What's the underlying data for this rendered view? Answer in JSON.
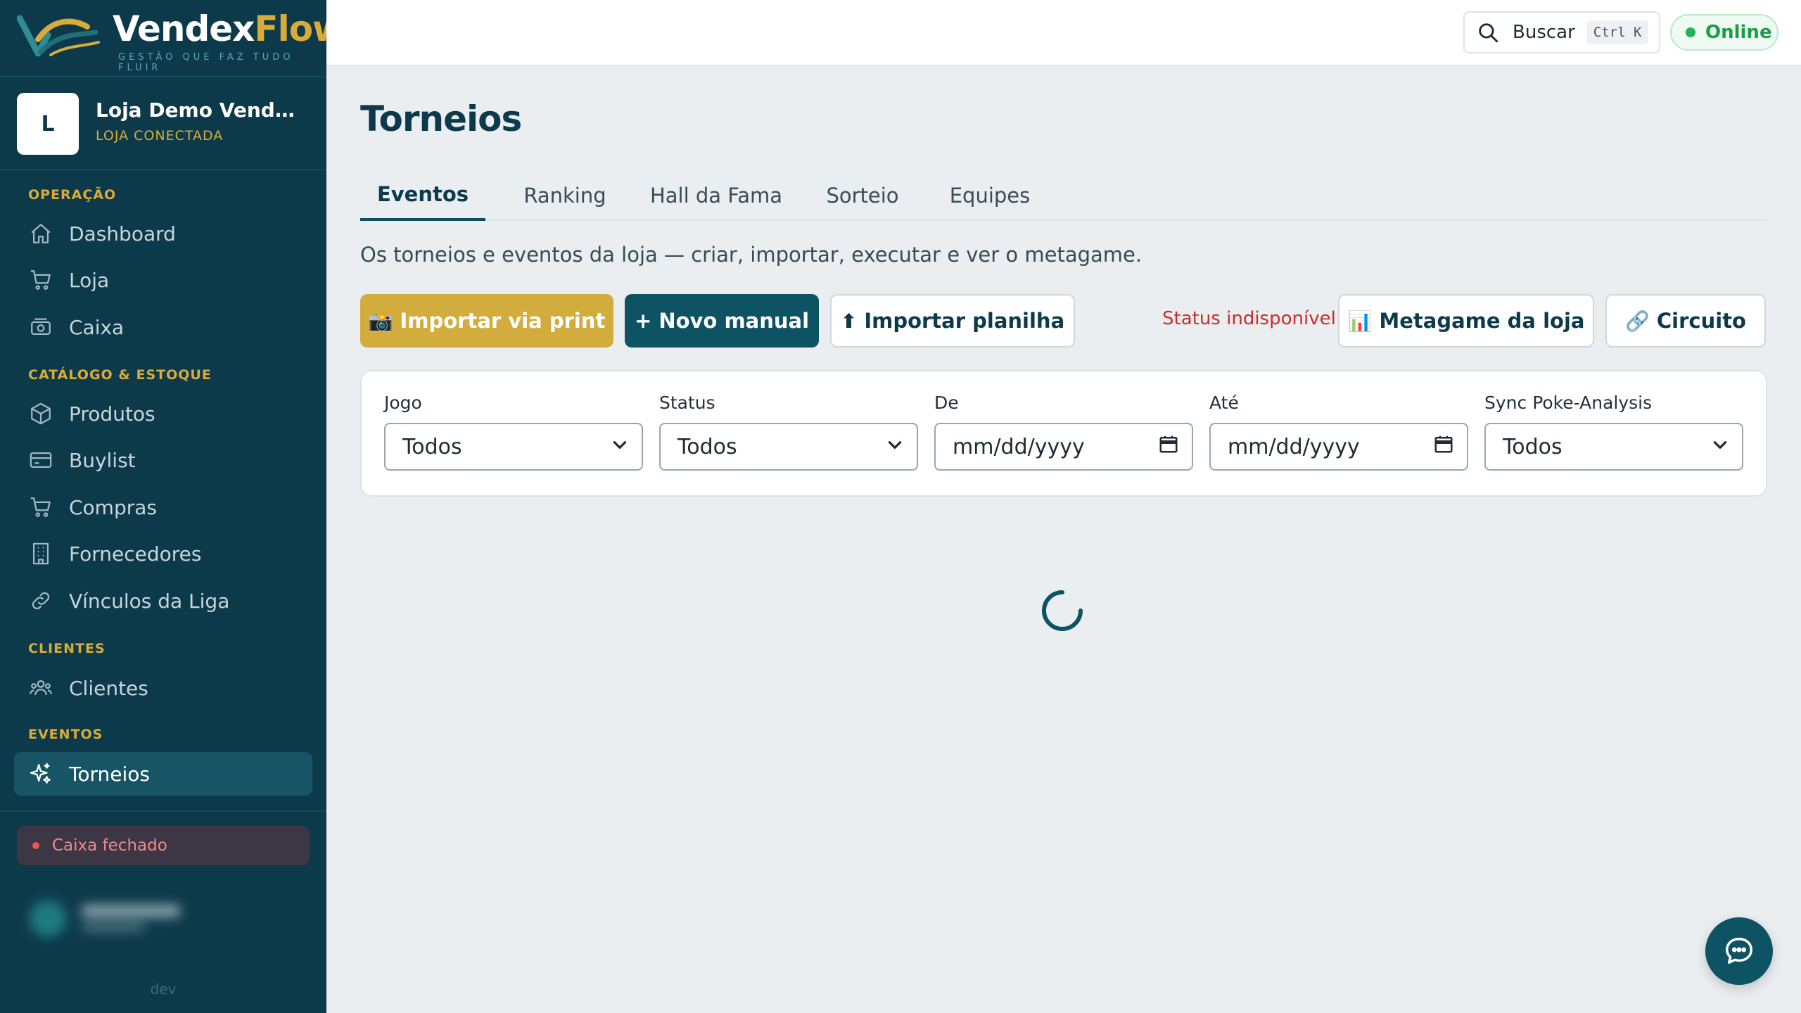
{
  "brand": {
    "name_part1": "Vendex",
    "name_part2": "Flow",
    "tagline": "GESTÃO QUE FAZ TUDO FLUIR",
    "colors": {
      "primary": "#0d3a4a",
      "accent": "#d9ac3a"
    }
  },
  "store": {
    "initial": "L",
    "name": "Loja Demo VendexFlow",
    "status": "LOJA CONECTADA"
  },
  "sidebar": {
    "sections": [
      {
        "label": "OPERAÇÃO",
        "items": [
          {
            "label": "Dashboard",
            "icon": "home-icon"
          },
          {
            "label": "Loja",
            "icon": "cart-icon"
          },
          {
            "label": "Caixa",
            "icon": "cash-register-icon"
          }
        ]
      },
      {
        "label": "CATÁLOGO & ESTOQUE",
        "items": [
          {
            "label": "Produtos",
            "icon": "box-icon"
          },
          {
            "label": "Buylist",
            "icon": "card-icon"
          },
          {
            "label": "Compras",
            "icon": "cart-icon"
          },
          {
            "label": "Fornecedores",
            "icon": "building-icon"
          },
          {
            "label": "Vínculos da Liga",
            "icon": "link-icon"
          }
        ]
      },
      {
        "label": "CLIENTES",
        "items": [
          {
            "label": "Clientes",
            "icon": "users-icon"
          }
        ]
      },
      {
        "label": "EVENTOS",
        "items": [
          {
            "label": "Torneios",
            "icon": "sparkles-icon",
            "active": true
          }
        ]
      }
    ],
    "cash_status": "Caixa fechado",
    "env": "dev"
  },
  "topbar": {
    "search_label": "Buscar",
    "search_shortcut": "Ctrl K",
    "connection": "Online"
  },
  "main": {
    "title": "Torneios",
    "tabs": [
      {
        "label": "Eventos",
        "active": true
      },
      {
        "label": "Ranking"
      },
      {
        "label": "Hall da Fama"
      },
      {
        "label": "Sorteio"
      },
      {
        "label": "Equipes"
      }
    ],
    "subtitle": "Os torneios e eventos da loja — criar, importar, executar e ver o metagame.",
    "actions": {
      "import_print": "Importar via print",
      "import_print_emoji": "📸",
      "new_manual": "+ Novo manual",
      "import_sheet": "Importar planilha",
      "import_sheet_emoji": "⬆",
      "status_unavailable": "Status indisponível",
      "metagame": "Metagame da loja",
      "metagame_emoji": "📊",
      "circuit": "Circuito",
      "circuit_emoji": "🔗"
    },
    "filters": {
      "game": {
        "label": "Jogo",
        "value": "Todos"
      },
      "status": {
        "label": "Status",
        "value": "Todos"
      },
      "from": {
        "label": "De",
        "value": "mm/dd/yyyy"
      },
      "to": {
        "label": "Até",
        "value": "mm/dd/yyyy"
      },
      "sync": {
        "label": "Sync Poke-Analysis",
        "value": "Todos"
      }
    }
  }
}
